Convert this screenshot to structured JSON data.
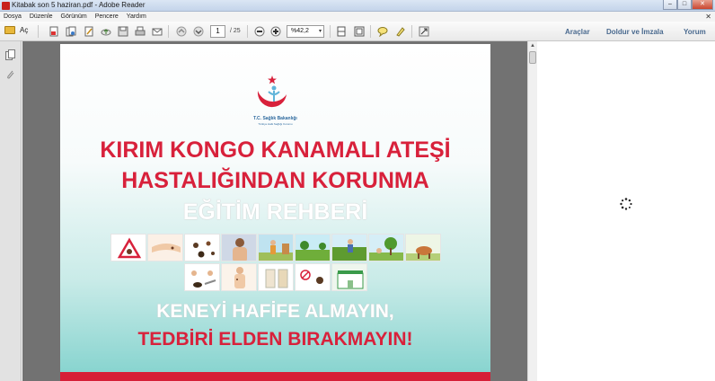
{
  "window": {
    "title": "Kitabak son 5 haziran.pdf - Adobe Reader",
    "controls": {
      "minimize": "–",
      "maximize": "□",
      "close": "✕"
    }
  },
  "menu": {
    "items": [
      "Dosya",
      "Düzenle",
      "Görünüm",
      "Pencere",
      "Yardım"
    ],
    "close_glyph": "✕"
  },
  "toolbar": {
    "open_label": "Aç",
    "page_current": "1",
    "page_total": "/ 25",
    "zoom": "%42,2",
    "zoom_arrow": "▾",
    "links": {
      "tools": "Araçlar",
      "fill_sign": "Doldur ve İmzala",
      "comment": "Yorum"
    },
    "icons": [
      "create-pdf-icon",
      "print-icon",
      "save-icon",
      "email-icon",
      "prev-page-icon",
      "next-page-icon",
      "zoom-out-icon",
      "zoom-in-icon",
      "fit-page-icon",
      "comment-icon",
      "highlight-icon",
      "read-mode-icon"
    ]
  },
  "document": {
    "logo_text": "T.C. Sağlık Bakanlığı",
    "logo_sub": "Türkiye Halk Sağlığı Kurumu",
    "headline_line1": "KIRIM KONGO KANAMALI ATEŞİ",
    "headline_line2": "HASTALIĞINDAN KORUNMA",
    "headline_line3": "EĞİTİM REHBERİ",
    "slogan_line1": "KENEYİ HAFİFE ALMAYIN,",
    "slogan_line2": "TEDBİRİ ELDEN BIRAKMAYIN!",
    "colors": {
      "red": "#d8213b",
      "teal": "#82d2cd",
      "logo_blue": "#5fb4d9"
    }
  }
}
